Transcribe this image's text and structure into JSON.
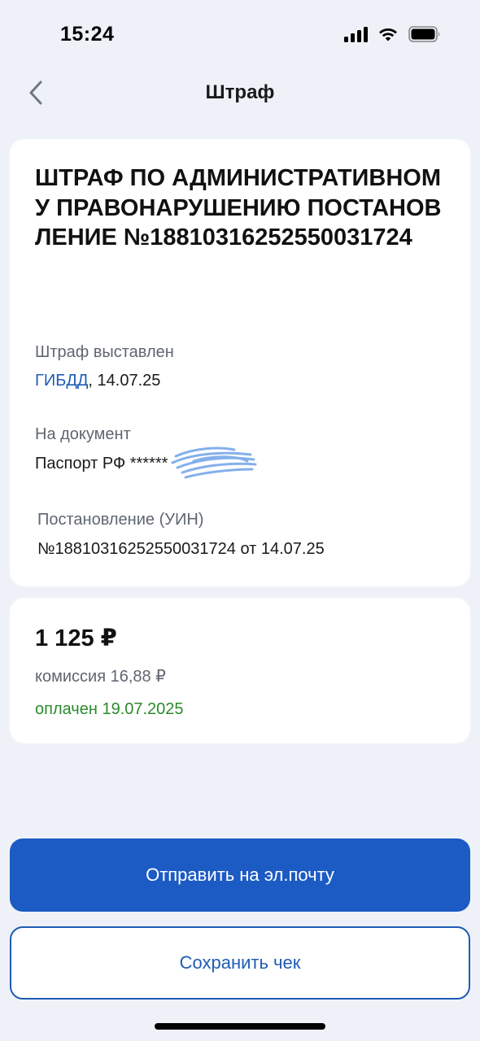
{
  "status_bar": {
    "time": "15:24"
  },
  "nav": {
    "title": "Штраф"
  },
  "fine": {
    "title": "ШТРАФ ПО АДМИНИСТРАТИВНОМУ ПРАВОНАРУШЕНИЮ ПОСТАНОВЛЕНИЕ №18810316252550031724",
    "issued_label": "Штраф выставлен",
    "issuer": "ГИБДД",
    "issued_date": ", 14.07.25",
    "document_label": "На документ",
    "document_value": "Паспорт РФ ******",
    "uin_label": "Постановление (УИН)",
    "uin_value": "№18810316252550031724 от 14.07.25"
  },
  "payment": {
    "amount": "1 125 ₽",
    "commission": "комиссия 16,88 ₽",
    "status": "оплачен 19.07.2025"
  },
  "actions": {
    "send_email": "Отправить на эл.почту",
    "save_receipt": "Сохранить чек"
  },
  "colors": {
    "accent": "#1c5bc4",
    "link": "#1f5cb5",
    "paid": "#2b8a2b",
    "background": "#eef2f8"
  },
  "icons": {
    "back": "chevron-left-icon",
    "signal": "cellular-signal-icon",
    "wifi": "wifi-icon",
    "battery": "battery-icon"
  }
}
